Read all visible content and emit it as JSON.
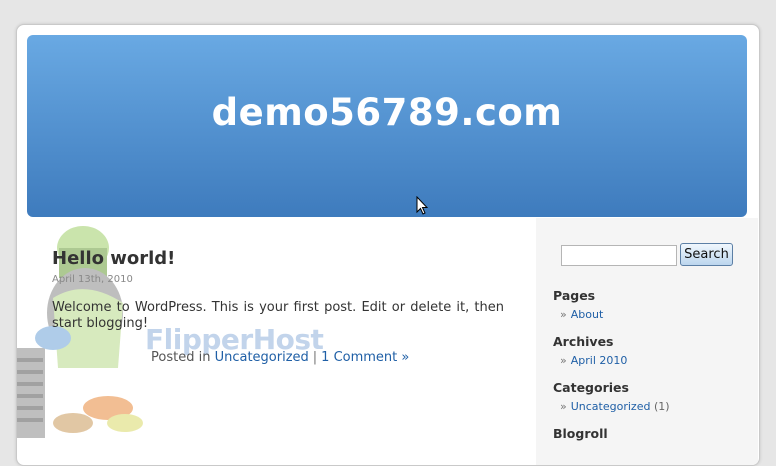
{
  "site": {
    "title": "demo56789.com"
  },
  "post": {
    "title": "Hello world!",
    "date": "April 13th, 2010",
    "body": "Welcome to WordPress. This is your first post. Edit or delete it, then start blogging!",
    "posted_in_label": "Posted in",
    "category_link": "Uncategorized",
    "separator": "|",
    "comments_link": "1 Comment »"
  },
  "watermark": "FlipperHost",
  "sidebar": {
    "search": {
      "value": "",
      "button_label": "Search"
    },
    "pages": {
      "title": "Pages",
      "items": [
        {
          "label": "About"
        }
      ]
    },
    "archives": {
      "title": "Archives",
      "items": [
        {
          "label": "April 2010"
        }
      ]
    },
    "categories": {
      "title": "Categories",
      "items": [
        {
          "label": "Uncategorized",
          "count": "(1)"
        }
      ]
    },
    "blogroll": {
      "title": "Blogroll"
    }
  },
  "icons": {
    "list_arrow": "»",
    "cursor": "mouse-pointer-icon"
  },
  "colors": {
    "header_top": "#69a9e3",
    "header_bottom": "#3e7bbd",
    "link": "#1f5fa6"
  }
}
